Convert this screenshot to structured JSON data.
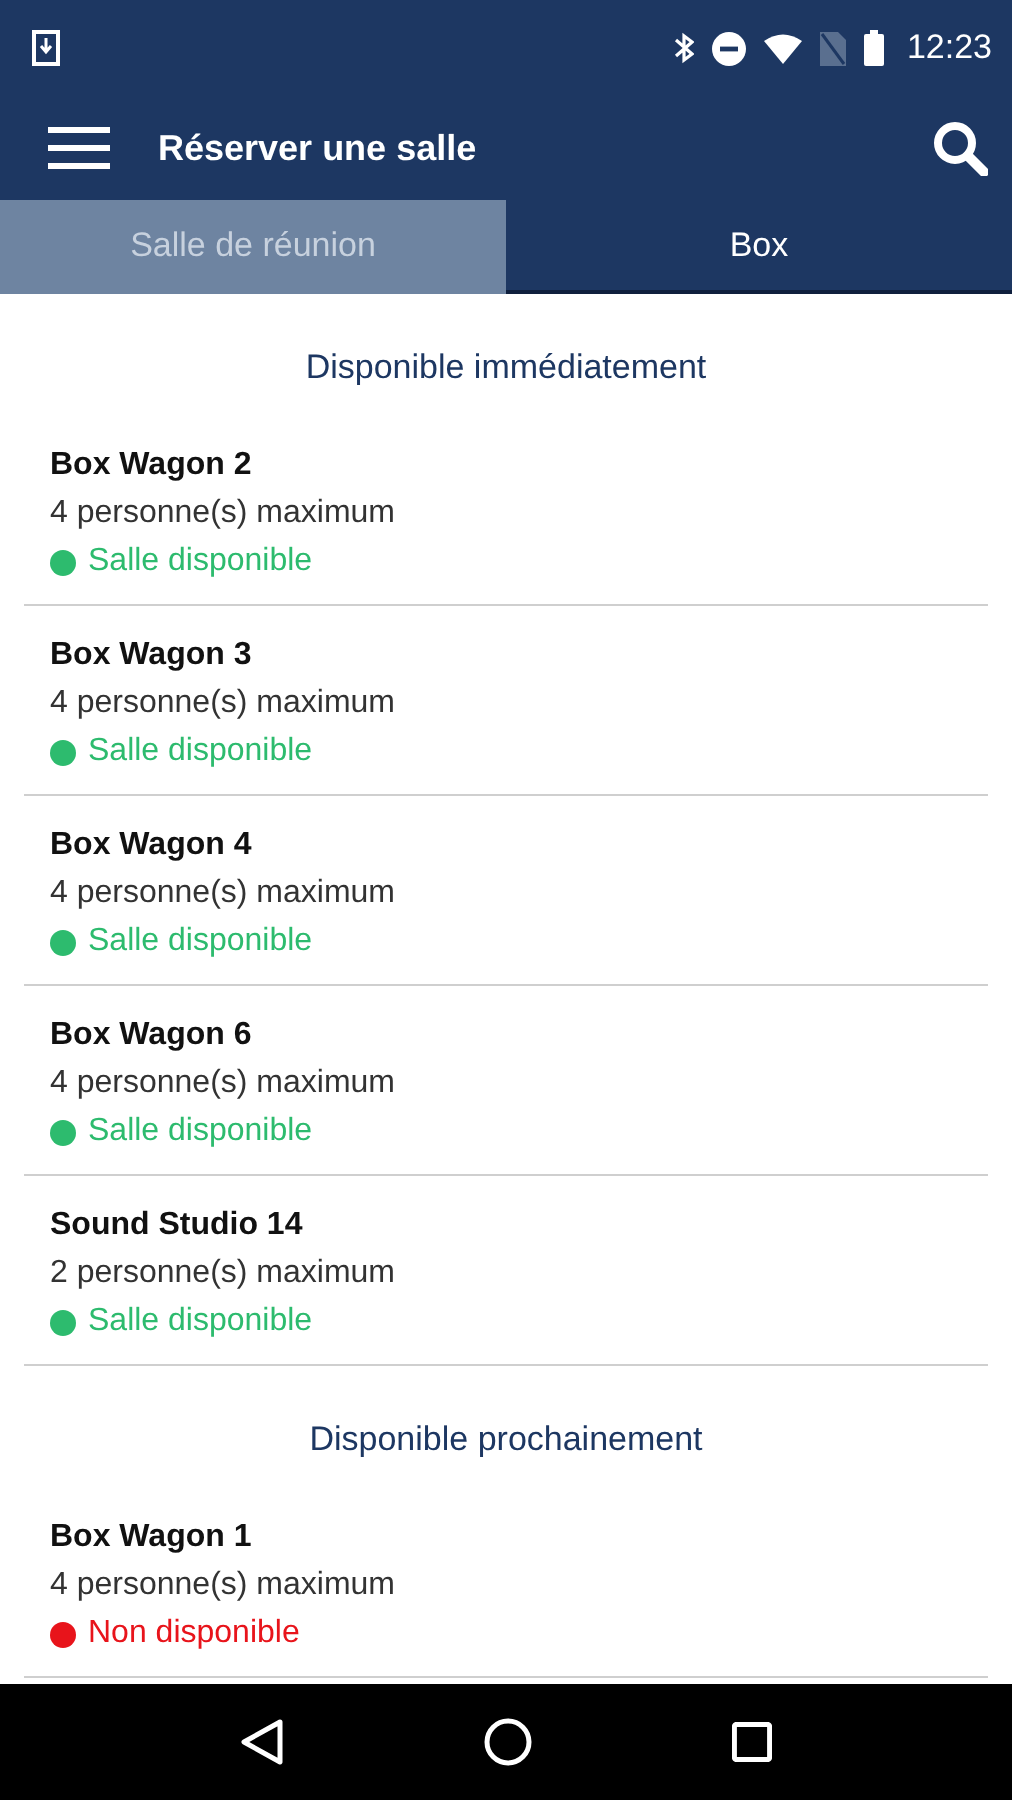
{
  "status_bar": {
    "time": "12:23"
  },
  "app_bar": {
    "title": "Réserver une salle"
  },
  "tabs": [
    {
      "label": "Salle de réunion",
      "selected": false
    },
    {
      "label": "Box",
      "selected": true
    }
  ],
  "sections": [
    {
      "title": "Disponible immédiatement",
      "rooms": [
        {
          "name": "Box Wagon 2",
          "capacity": "4 personne(s) maximum",
          "status": "Salle disponible",
          "color": "#2dbb6e"
        },
        {
          "name": "Box Wagon 3",
          "capacity": "4 personne(s) maximum",
          "status": "Salle disponible",
          "color": "#2dbb6e"
        },
        {
          "name": "Box Wagon 4",
          "capacity": "4 personne(s) maximum",
          "status": "Salle disponible",
          "color": "#2dbb6e"
        },
        {
          "name": "Box Wagon 6",
          "capacity": "4 personne(s) maximum",
          "status": "Salle disponible",
          "color": "#2dbb6e"
        },
        {
          "name": "Sound Studio 14",
          "capacity": "2 personne(s) maximum",
          "status": "Salle disponible",
          "color": "#2dbb6e"
        }
      ]
    },
    {
      "title": "Disponible prochainement",
      "rooms": [
        {
          "name": "Box Wagon 1",
          "capacity": "4 personne(s) maximum",
          "status": "Non disponible",
          "color": "#e8141b"
        }
      ]
    }
  ]
}
